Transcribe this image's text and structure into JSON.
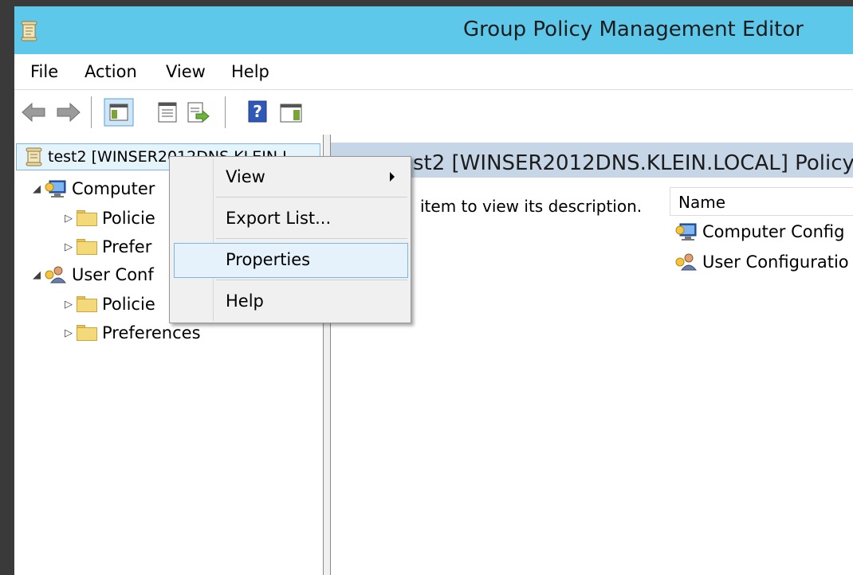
{
  "window": {
    "title": "Group Policy Management Editor"
  },
  "menu": [
    "File",
    "Action",
    "View",
    "Help"
  ],
  "toolbar": {
    "icons": [
      "back-arrow-icon",
      "forward-arrow-icon",
      "show-hide-console-tree-icon",
      "properties-icon",
      "export-list-icon",
      "help-icon",
      "show-hide-action-pane-icon"
    ]
  },
  "tree": {
    "root": "test2 [WINSER2012DNS.KLEIN.L",
    "computer": {
      "label": "Computer",
      "children": [
        "Policie",
        "Prefer"
      ]
    },
    "user": {
      "label": "User Conf",
      "children": [
        "Policie",
        "Preferences"
      ]
    }
  },
  "right_pane": {
    "header": "st2 [WINSER2012DNS.KLEIN.LOCAL] Policy",
    "description": "item to view its description.",
    "column_name": "Name",
    "items": [
      "Computer Config",
      "User Configuratio"
    ]
  },
  "context_menu": {
    "items": [
      "View",
      "Export List...",
      "Properties",
      "Help"
    ],
    "highlighted": "Properties"
  },
  "colors": {
    "titlebar": "#5ec8ea",
    "highlight": "#e5f1fb",
    "selection_border": "#7ab6e8"
  }
}
